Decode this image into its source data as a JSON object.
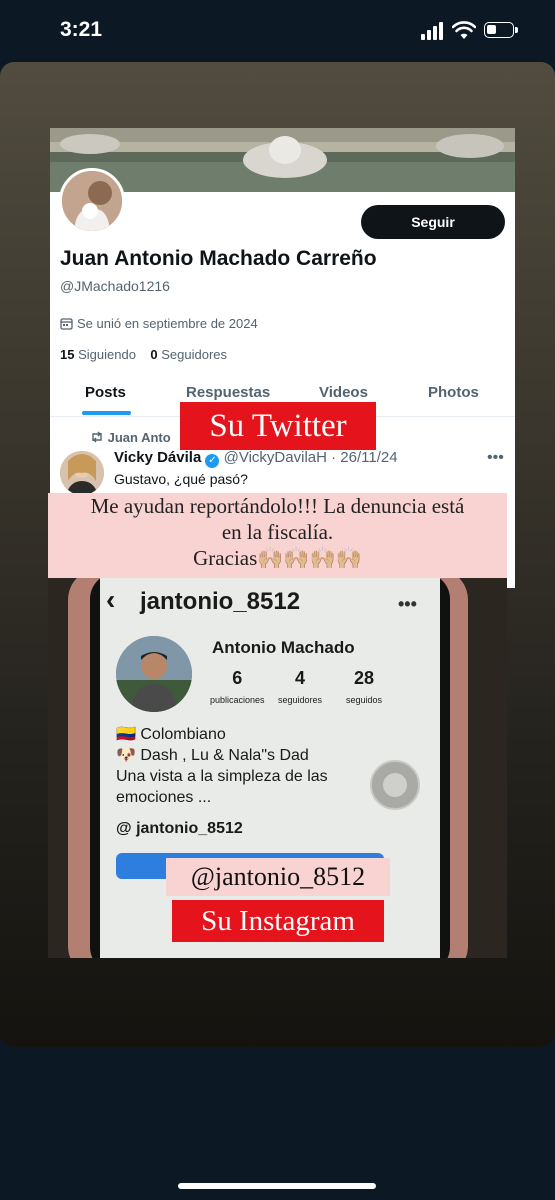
{
  "status_bar": {
    "time": "3:21"
  },
  "twitter": {
    "follow_label": "Seguir",
    "name": "Juan Antonio Machado Carreño",
    "handle": "@JMachado1216",
    "joined": "Se unió en septiembre de 2024",
    "following_count": "15",
    "following_label": "Siguiendo",
    "followers_count": "0",
    "followers_label": "Seguidores",
    "tabs": [
      {
        "label": "Posts"
      },
      {
        "label": "Respuestas"
      },
      {
        "label": "Videos"
      },
      {
        "label": "Photos"
      }
    ],
    "repost_label": "Juan Anto",
    "tweet": {
      "author": "Vicky Dávila",
      "handle_date": "@VickyDavilaH · 26/11/24",
      "text": "Gustavo, ¿qué pasó?"
    }
  },
  "overlay": {
    "twitter_label": "Su Twitter",
    "message_line1": "Me ayudan reportándolo!!! La denuncia está",
    "message_line2": "en la fiscalía.",
    "message_line3": "Gracias🙌🏼🙌🏼🙌🏼🙌🏼",
    "instagram_handle_label": "@jantonio_8512",
    "instagram_label": "Su Instagram"
  },
  "instagram": {
    "handle": "jantonio_8512",
    "name": "Antonio Machado",
    "posts_count": "6",
    "posts_label": "publicaciones",
    "followers_count": "4",
    "followers_label": "seguidores",
    "following_count": "28",
    "following_label": "seguidos",
    "bio": [
      "🇨🇴 Colombiano",
      "🐶 Dash , Lu & Nala\"s Dad",
      "Una vista a la simpleza de las",
      "emociones ..."
    ],
    "threads_handle": "jantonio_8512"
  },
  "colors": {
    "red_label": "#e5131b",
    "pink_banner": "#f8d3d1",
    "twitter_blue": "#1d9bf0",
    "dark_bg": "#0c1824"
  }
}
